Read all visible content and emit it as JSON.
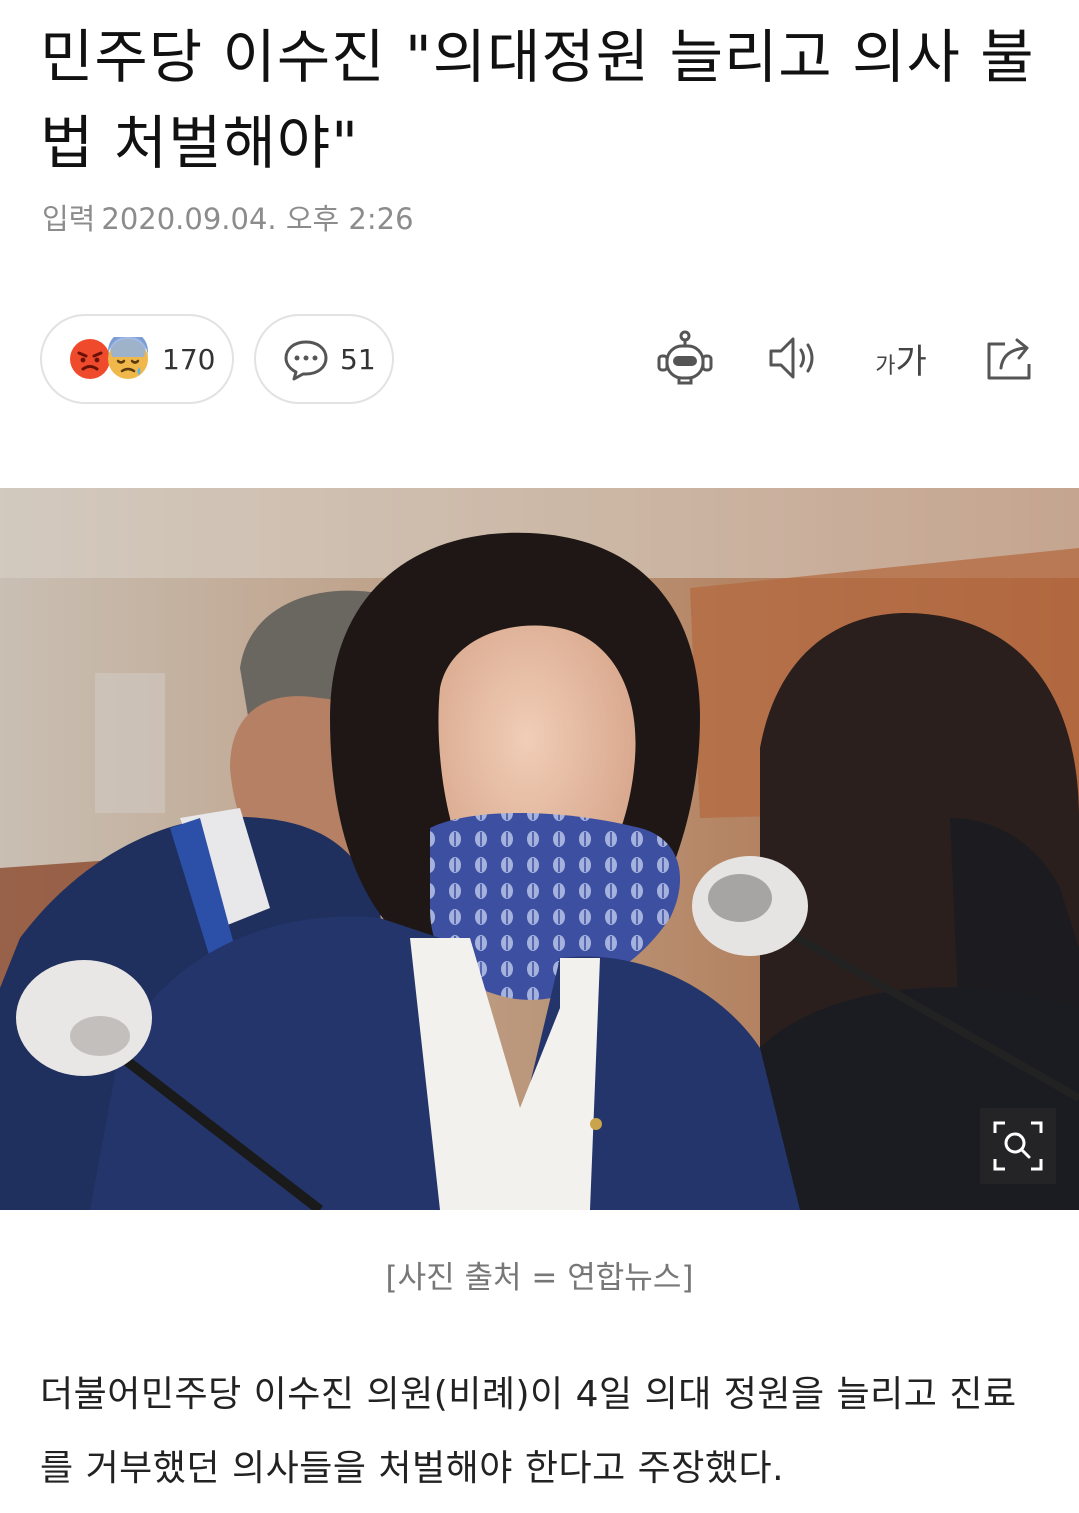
{
  "article": {
    "headline": "민주당 이수진 \"의대정원 늘리고 의사 불법 처벌해야\"",
    "date_label": "입력",
    "date_value": "2020.09.04. 오후 2:26"
  },
  "toolbar": {
    "reaction_count": "170",
    "comment_count": "51",
    "font_size_small": "가",
    "font_size_large": "가"
  },
  "photo": {
    "caption": "[사진 출처 = 연합뉴스]"
  },
  "body": {
    "paragraph": "더불어민주당 이수진 의원(비례)이 4일 의대 정원을 늘리고 진료를 거부했던 의사들을 처벌해야 한다고 주장했다."
  },
  "icons": {
    "reactions": [
      "angry-face-icon",
      "sad-face-icon"
    ],
    "comment": "speech-bubble-icon",
    "tools": [
      "robot-icon",
      "speaker-icon",
      "font-size-icon",
      "share-icon"
    ],
    "photo": "zoom-icon"
  },
  "colors": {
    "headline": "#111111",
    "meta": "#8c8c8c",
    "angry_emoji": "#ee4a2b",
    "sad_emoji": "#f0b84a"
  }
}
